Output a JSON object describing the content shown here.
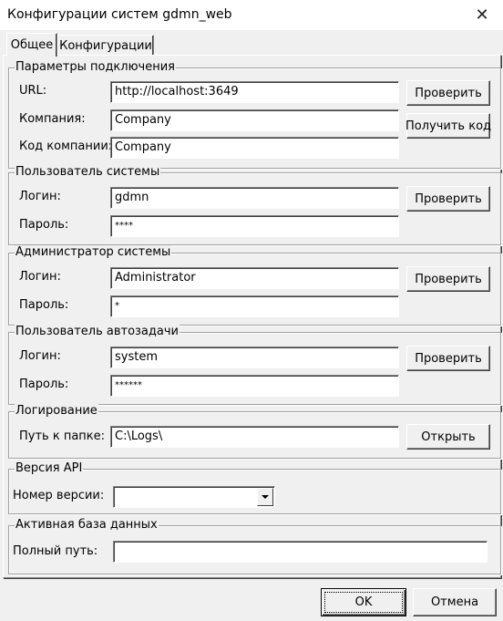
{
  "window": {
    "title": "Конфигурации систем gdmn_web"
  },
  "tabs": [
    {
      "label": "Общее"
    },
    {
      "label": "Конфигурации"
    }
  ],
  "connection": {
    "legend": "Параметры подключения",
    "url_label": "URL:",
    "url_value": "http://localhost:3649",
    "company_label": "Компания:",
    "company_value": "Company",
    "company_code_label": "Код компании:",
    "company_code_value": "Company",
    "check_label": "Проверить",
    "get_code_label": "Получить код"
  },
  "system_user": {
    "legend": "Пользователь системы",
    "login_label": "Логин:",
    "login_value": "gdmn",
    "password_label": "Пароль:",
    "password_value": "****",
    "check_label": "Проверить"
  },
  "admin": {
    "legend": "Администратор системы",
    "login_label": "Логин:",
    "login_value": "Administrator",
    "password_label": "Пароль:",
    "password_value": "*",
    "check_label": "Проверить"
  },
  "autotask_user": {
    "legend": "Пользователь автозадачи",
    "login_label": "Логин:",
    "login_value": "system",
    "password_label": "Пароль:",
    "password_value": "******",
    "check_label": "Проверить"
  },
  "logging": {
    "legend": "Логирование",
    "path_label": "Путь к папке:",
    "path_value": "C:\\Logs\\",
    "open_label": "Открыть"
  },
  "api_version": {
    "legend": "Версия API",
    "version_label": "Номер версии:",
    "version_value": ""
  },
  "active_db": {
    "legend": "Активная база данных",
    "path_label": "Полный путь:",
    "path_value": ""
  },
  "footer": {
    "ok_label": "OK",
    "cancel_label": "Отмена"
  }
}
